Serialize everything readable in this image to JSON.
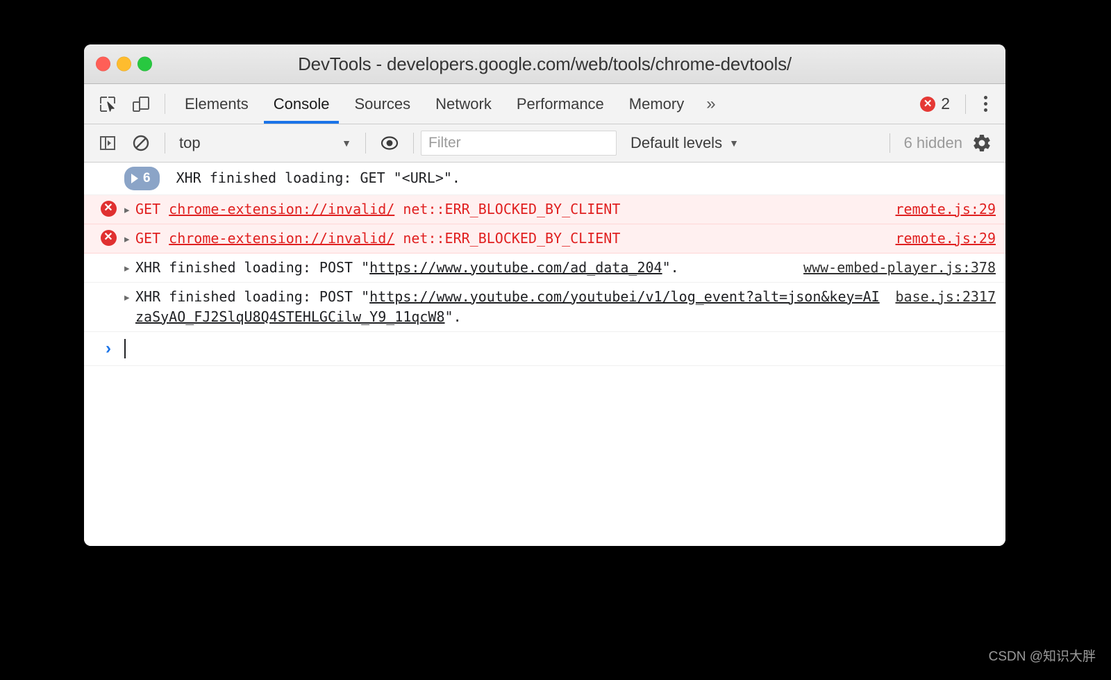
{
  "window": {
    "title": "DevTools - developers.google.com/web/tools/chrome-devtools/",
    "traffic_lights": {
      "close": "close-button",
      "minimize": "minimize-button",
      "maximize": "maximize-button"
    },
    "colors": {
      "accent_blue": "#1a73e8",
      "error_red": "#e02020",
      "error_row_bg": "#fff0f0",
      "toolbar_bg": "#f3f3f3",
      "group_pill_bg": "#8ba4c7",
      "traffic_red": "#ff5f57",
      "traffic_yellow": "#febc2e",
      "traffic_green": "#28c840"
    }
  },
  "toolbar": {
    "inspect_icon": "inspect-element-icon",
    "device_icon": "device-toolbar-icon",
    "tabs": [
      {
        "label": "Elements",
        "active": false
      },
      {
        "label": "Console",
        "active": true
      },
      {
        "label": "Sources",
        "active": false
      },
      {
        "label": "Network",
        "active": false
      },
      {
        "label": "Performance",
        "active": false
      },
      {
        "label": "Memory",
        "active": false
      }
    ],
    "more_tabs_label": "»",
    "error_badge_glyph": "✕",
    "error_count": "2",
    "menu_icon": "kebab-menu-icon"
  },
  "filterbar": {
    "sidebar_toggle_icon": "console-sidebar-icon",
    "clear_icon": "clear-console-icon",
    "context_value": "top",
    "context_caret": "▼",
    "eye_icon": "live-expression-icon",
    "filter_placeholder": "Filter",
    "filter_value": "",
    "levels_label": "Default levels",
    "levels_caret": "▼",
    "hidden_label": "6 hidden",
    "settings_icon": "settings-gear-icon"
  },
  "console": {
    "rows": [
      {
        "kind": "group",
        "badge_count": "6",
        "badge_play": "play-triangle-icon",
        "text": "XHR finished loading: GET \"<URL>\".",
        "source": ""
      },
      {
        "kind": "error",
        "icon": "error-circle-icon",
        "disclosure": "▸",
        "prefix": "GET ",
        "link": "chrome-extension://invalid/",
        "suffix": " net::ERR_BLOCKED_BY_CLIENT",
        "source": "remote.js:29"
      },
      {
        "kind": "error",
        "icon": "error-circle-icon",
        "disclosure": "▸",
        "prefix": "GET ",
        "link": "chrome-extension://invalid/",
        "suffix": " net::ERR_BLOCKED_BY_CLIENT",
        "source": "remote.js:29"
      },
      {
        "kind": "info",
        "disclosure": "▸",
        "prefix": "XHR finished loading: POST \"",
        "link": "https://www.youtube.com/ad_data_204",
        "suffix": "\".",
        "source": "www-embed-player.js:378"
      },
      {
        "kind": "info",
        "disclosure": "▸",
        "prefix": "XHR finished loading: POST \"",
        "link": "https://www.youtube.com/youtubei/v1/log_event?alt=json&key=AIzaSyAO_FJ2SlqU8Q4STEHLGCilw_Y9_11qcW8",
        "suffix": "\".",
        "source": "base.js:2317"
      }
    ],
    "prompt": {
      "chevron": "›",
      "value": ""
    }
  },
  "watermark": {
    "text": "CSDN @知识大胖"
  }
}
